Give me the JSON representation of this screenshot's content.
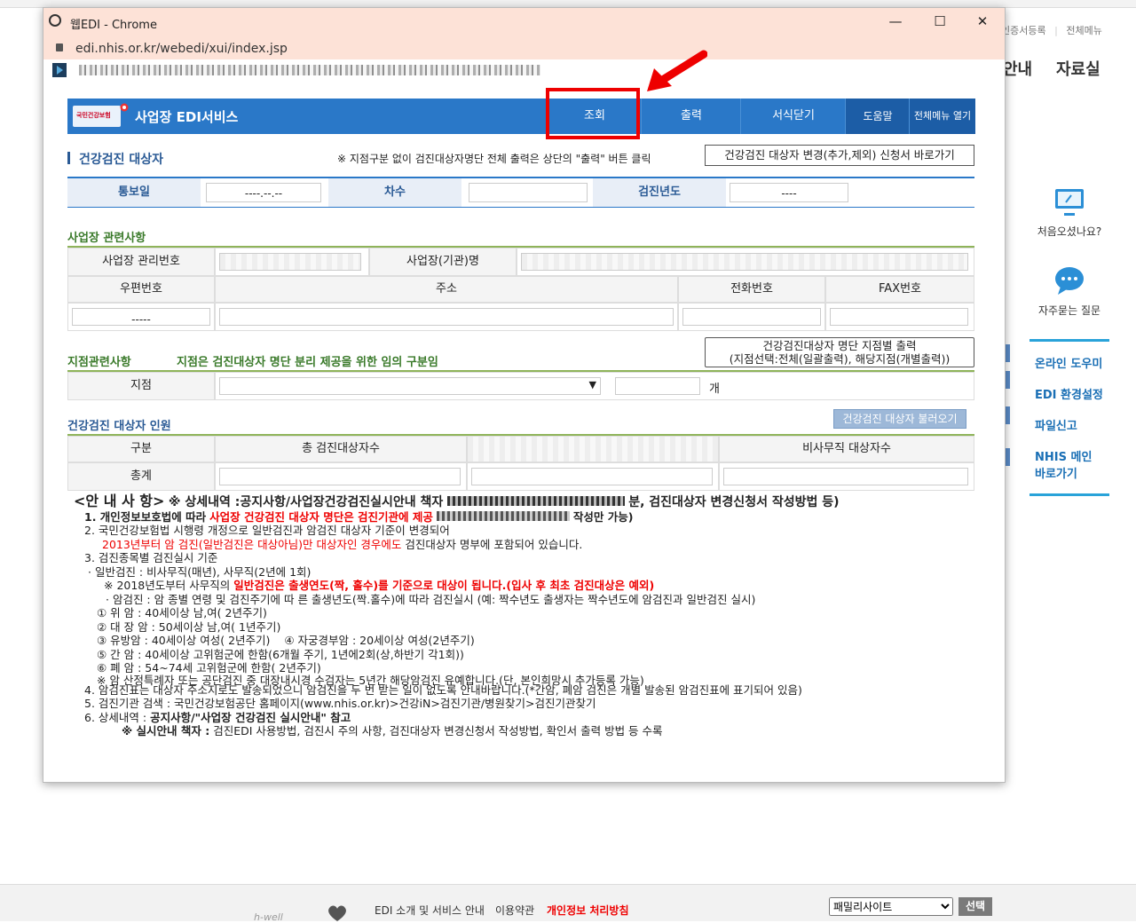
{
  "background": {
    "toplinks": [
      "인증서등록",
      "전체메뉴"
    ],
    "menu": [
      "안내",
      "자료실"
    ],
    "right_panel": {
      "first_visit": "처음오셨나요?",
      "faq": "자주묻는 질문",
      "links": [
        "온라인 도우미",
        "EDI 환경설정",
        "파일신고",
        "NHIS 메인 바로가기"
      ]
    },
    "footer": {
      "logo": "h-well",
      "links": [
        "EDI 소개 및 서비스 안내",
        "이용약관",
        "개인정보 처리방침"
      ],
      "family_site": "패밀리사이트",
      "select_button": "선택"
    }
  },
  "window": {
    "title": "웹EDI - Chrome",
    "url": "edi.nhis.or.kr/webedi/xui/index.jsp",
    "controls": {
      "minimize": "—",
      "maximize": "☐",
      "close": "✕"
    }
  },
  "edi": {
    "logo_text": "국민건강보험",
    "service_title": "사업장 EDI서비스",
    "nav": [
      "조회",
      "출력",
      "서식닫기",
      "도움말",
      "전체메뉴 열기"
    ]
  },
  "section1": {
    "title": "건강검진 대상자",
    "hint": "※ 지점구분 없이 검진대상자명단 전체 출력은 상단의 \"출력\" 버튼 클릭",
    "change_button": "건강검진 대상자 변경(추가,제외) 신청서 바로가기",
    "notice_date_label": "통보일",
    "notice_date_value": "----.--.--",
    "round_label": "차수",
    "round_value": "",
    "year_label": "검진년도",
    "year_value": "----"
  },
  "section2": {
    "title": "사업장 관련사항",
    "mgmt_no_label": "사업장 관리번호",
    "name_label": "사업장(기관)명",
    "zip_label": "우편번호",
    "zip_value": "-----",
    "address_label": "주소",
    "phone_label": "전화번호",
    "fax_label": "FAX번호"
  },
  "section3": {
    "title": "지점관련사항",
    "note": "지점은 검진대상자 명단 분리 제공을 위한 임의 구분임",
    "print_button_line1": "건강검진대상자 명단 지점별 출력",
    "print_button_line2": "(지점선택:전체(일괄출력), 해당지점(개별출력))",
    "branch_label": "지점",
    "count_unit": "개"
  },
  "section4": {
    "title": "건강검진 대상자 인원",
    "load_button": "건강검진 대상자 불러오기",
    "col_category": "구분",
    "col_total": "총 검진대상자수",
    "col_nonoffice": "비사무직 대상자수",
    "row_total": "총계"
  },
  "notes": {
    "head_title": "<안 내 사 항>",
    "head_detail": "※ 상세내역 :공지사항/사업장건강검진실시안내 책자",
    "head_tail": "분, 검진대상자 변경신청서 작성방법 등)",
    "n1_a": "1. 개인정보보호법에 따라",
    "n1_b": "사업장 건강검진 대상자 명단은 검진기관에 제공",
    "n1_c": "작성만 가능)",
    "n2": "2. 국민건강보험법 시행령 개정으로 일반검진과 암검진 대상자 기준이 변경되어",
    "n2_red": "2013년부터 암 검진(일반검진은 대상아님)만 대상자인 경우에도",
    "n2_tail": "검진대상자 명부에 포함되어 있습니다.",
    "n3": "3. 검진종목별 검진실시 기준",
    "n3_general": "· 일반검진 : 비사무직(매년), 사무직(2년에 1회)",
    "n3_note_a": "※ 2018년도부터 사무직의",
    "n3_note_b": "일반검진은 출생연도(짝, 홀수)를 기준으로 대상이 됩니다.(입사 후 최초 검진대상은 예외)",
    "n3_cancer": "· 암검진 : 암 종별 연령 및 검진주기에 따 른 출생년도(짝.홀수)에 따라 검진실시 (예: 짝수년도 출생자는 짝수년도에 암검진과 일반검진 실시)",
    "c1": "① 위   암 : 40세이상 남,여( 2년주기)",
    "c2": "② 대  장  암 : 50세이상 남,여( 1년주기)",
    "c3": "③ 유방암 : 40세이상 여성( 2년주기)",
    "c4": "④ 자궁경부암 : 20세이상 여성(2년주기)",
    "c5": "⑤ 간   암 : 40세이상 고위험군에 한함(6개월 주기, 1년에2회(상,하반기 각1회))",
    "c6": "⑥ 폐   암 : 54~74세 고위험군에 한함( 2년주기)",
    "c_note": "※ 암 산정특례자 또는 공단검진 중 대장내시경 수검자는 5년간 해당암검진 유예합니다.(단, 본인희망시 추가등록 가능)",
    "n4": "4. 암검진표는 대상자 주소지로도 발송되었으니 암검진을 두 번 받는 일이 없도록 안내바랍니다.(*간암, 폐암 검진은 개별 발송된  암검진표에 표기되어 있음)",
    "n5": "5. 검진기관 검색 : 국민건강보험공단 홈페이지(www.nhis.or.kr)>건강iN>검진기관/병원찾기>검진기관찾기",
    "n6_a": "6. 상세내역 :",
    "n6_b": "공지사항/\"사업장 건강검진 실시안내\" 참고",
    "n6_c": "※ 실시안내 책자 :",
    "n6_d": "검진EDI 사용방법, 검진시 주의 사항, 검진대상자 변경신청서 작성방법, 확인서 출력 방법 등 수록"
  },
  "colors": {
    "accent": "#2a78c8",
    "highlight": "#e00000",
    "titlebar": "#fde2d7"
  }
}
